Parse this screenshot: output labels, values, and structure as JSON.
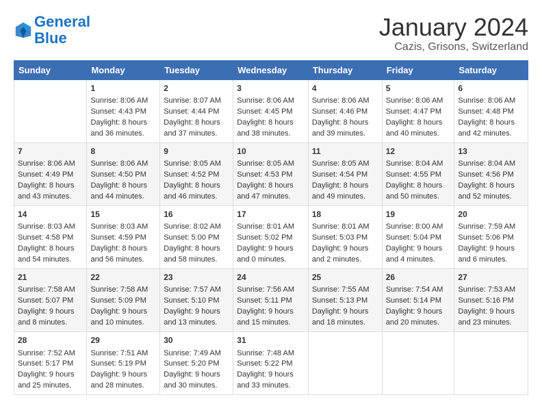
{
  "logo": {
    "line1": "General",
    "line2": "Blue"
  },
  "title": "January 2024",
  "subtitle": "Cazis, Grisons, Switzerland",
  "days_of_week": [
    "Sunday",
    "Monday",
    "Tuesday",
    "Wednesday",
    "Thursday",
    "Friday",
    "Saturday"
  ],
  "weeks": [
    [
      {
        "day": "",
        "sunrise": "",
        "sunset": "",
        "daylight": ""
      },
      {
        "day": "1",
        "sunrise": "Sunrise: 8:06 AM",
        "sunset": "Sunset: 4:43 PM",
        "daylight": "Daylight: 8 hours and 36 minutes."
      },
      {
        "day": "2",
        "sunrise": "Sunrise: 8:07 AM",
        "sunset": "Sunset: 4:44 PM",
        "daylight": "Daylight: 8 hours and 37 minutes."
      },
      {
        "day": "3",
        "sunrise": "Sunrise: 8:06 AM",
        "sunset": "Sunset: 4:45 PM",
        "daylight": "Daylight: 8 hours and 38 minutes."
      },
      {
        "day": "4",
        "sunrise": "Sunrise: 8:06 AM",
        "sunset": "Sunset: 4:46 PM",
        "daylight": "Daylight: 8 hours and 39 minutes."
      },
      {
        "day": "5",
        "sunrise": "Sunrise: 8:06 AM",
        "sunset": "Sunset: 4:47 PM",
        "daylight": "Daylight: 8 hours and 40 minutes."
      },
      {
        "day": "6",
        "sunrise": "Sunrise: 8:06 AM",
        "sunset": "Sunset: 4:48 PM",
        "daylight": "Daylight: 8 hours and 42 minutes."
      }
    ],
    [
      {
        "day": "7",
        "sunrise": "Sunrise: 8:06 AM",
        "sunset": "Sunset: 4:49 PM",
        "daylight": "Daylight: 8 hours and 43 minutes."
      },
      {
        "day": "8",
        "sunrise": "Sunrise: 8:06 AM",
        "sunset": "Sunset: 4:50 PM",
        "daylight": "Daylight: 8 hours and 44 minutes."
      },
      {
        "day": "9",
        "sunrise": "Sunrise: 8:05 AM",
        "sunset": "Sunset: 4:52 PM",
        "daylight": "Daylight: 8 hours and 46 minutes."
      },
      {
        "day": "10",
        "sunrise": "Sunrise: 8:05 AM",
        "sunset": "Sunset: 4:53 PM",
        "daylight": "Daylight: 8 hours and 47 minutes."
      },
      {
        "day": "11",
        "sunrise": "Sunrise: 8:05 AM",
        "sunset": "Sunset: 4:54 PM",
        "daylight": "Daylight: 8 hours and 49 minutes."
      },
      {
        "day": "12",
        "sunrise": "Sunrise: 8:04 AM",
        "sunset": "Sunset: 4:55 PM",
        "daylight": "Daylight: 8 hours and 50 minutes."
      },
      {
        "day": "13",
        "sunrise": "Sunrise: 8:04 AM",
        "sunset": "Sunset: 4:56 PM",
        "daylight": "Daylight: 8 hours and 52 minutes."
      }
    ],
    [
      {
        "day": "14",
        "sunrise": "Sunrise: 8:03 AM",
        "sunset": "Sunset: 4:58 PM",
        "daylight": "Daylight: 8 hours and 54 minutes."
      },
      {
        "day": "15",
        "sunrise": "Sunrise: 8:03 AM",
        "sunset": "Sunset: 4:59 PM",
        "daylight": "Daylight: 8 hours and 56 minutes."
      },
      {
        "day": "16",
        "sunrise": "Sunrise: 8:02 AM",
        "sunset": "Sunset: 5:00 PM",
        "daylight": "Daylight: 8 hours and 58 minutes."
      },
      {
        "day": "17",
        "sunrise": "Sunrise: 8:01 AM",
        "sunset": "Sunset: 5:02 PM",
        "daylight": "Daylight: 9 hours and 0 minutes."
      },
      {
        "day": "18",
        "sunrise": "Sunrise: 8:01 AM",
        "sunset": "Sunset: 5:03 PM",
        "daylight": "Daylight: 9 hours and 2 minutes."
      },
      {
        "day": "19",
        "sunrise": "Sunrise: 8:00 AM",
        "sunset": "Sunset: 5:04 PM",
        "daylight": "Daylight: 9 hours and 4 minutes."
      },
      {
        "day": "20",
        "sunrise": "Sunrise: 7:59 AM",
        "sunset": "Sunset: 5:06 PM",
        "daylight": "Daylight: 9 hours and 6 minutes."
      }
    ],
    [
      {
        "day": "21",
        "sunrise": "Sunrise: 7:58 AM",
        "sunset": "Sunset: 5:07 PM",
        "daylight": "Daylight: 9 hours and 8 minutes."
      },
      {
        "day": "22",
        "sunrise": "Sunrise: 7:58 AM",
        "sunset": "Sunset: 5:09 PM",
        "daylight": "Daylight: 9 hours and 10 minutes."
      },
      {
        "day": "23",
        "sunrise": "Sunrise: 7:57 AM",
        "sunset": "Sunset: 5:10 PM",
        "daylight": "Daylight: 9 hours and 13 minutes."
      },
      {
        "day": "24",
        "sunrise": "Sunrise: 7:56 AM",
        "sunset": "Sunset: 5:11 PM",
        "daylight": "Daylight: 9 hours and 15 minutes."
      },
      {
        "day": "25",
        "sunrise": "Sunrise: 7:55 AM",
        "sunset": "Sunset: 5:13 PM",
        "daylight": "Daylight: 9 hours and 18 minutes."
      },
      {
        "day": "26",
        "sunrise": "Sunrise: 7:54 AM",
        "sunset": "Sunset: 5:14 PM",
        "daylight": "Daylight: 9 hours and 20 minutes."
      },
      {
        "day": "27",
        "sunrise": "Sunrise: 7:53 AM",
        "sunset": "Sunset: 5:16 PM",
        "daylight": "Daylight: 9 hours and 23 minutes."
      }
    ],
    [
      {
        "day": "28",
        "sunrise": "Sunrise: 7:52 AM",
        "sunset": "Sunset: 5:17 PM",
        "daylight": "Daylight: 9 hours and 25 minutes."
      },
      {
        "day": "29",
        "sunrise": "Sunrise: 7:51 AM",
        "sunset": "Sunset: 5:19 PM",
        "daylight": "Daylight: 9 hours and 28 minutes."
      },
      {
        "day": "30",
        "sunrise": "Sunrise: 7:49 AM",
        "sunset": "Sunset: 5:20 PM",
        "daylight": "Daylight: 9 hours and 30 minutes."
      },
      {
        "day": "31",
        "sunrise": "Sunrise: 7:48 AM",
        "sunset": "Sunset: 5:22 PM",
        "daylight": "Daylight: 9 hours and 33 minutes."
      },
      {
        "day": "",
        "sunrise": "",
        "sunset": "",
        "daylight": ""
      },
      {
        "day": "",
        "sunrise": "",
        "sunset": "",
        "daylight": ""
      },
      {
        "day": "",
        "sunrise": "",
        "sunset": "",
        "daylight": ""
      }
    ]
  ]
}
